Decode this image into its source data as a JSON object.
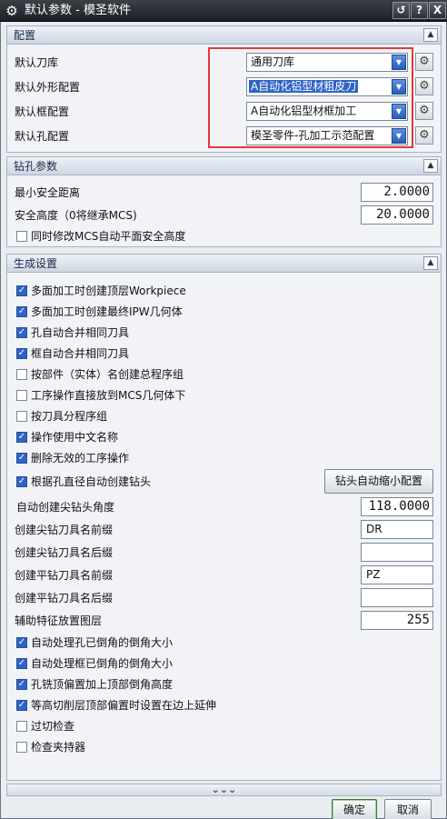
{
  "window": {
    "title": "默认参数 - 模圣软件",
    "btn_restore": "↺",
    "btn_help": "?",
    "btn_close": "X"
  },
  "colors": {
    "accent": "#2f63c5",
    "highlight_box": "#e23a3a"
  },
  "config": {
    "header": "配置",
    "rows": [
      {
        "label": "默认刀库",
        "value": "通用刀库"
      },
      {
        "label": "默认外形配置",
        "value": "A自动化铝型材粗皮刀"
      },
      {
        "label": "默认框配置",
        "value": "A自动化铝型材框加工"
      },
      {
        "label": "默认孔配置",
        "value": "模圣零件-孔加工示范配置"
      }
    ]
  },
  "drill": {
    "header": "钻孔参数",
    "min_safe_label": "最小安全距离",
    "min_safe_value": "2.0000",
    "safe_height_label": "安全高度（0将继承MCS)",
    "safe_height_value": "20.0000",
    "sync_label": "同时修改MCS自动平面安全高度"
  },
  "gen": {
    "header": "生成设置",
    "checks": [
      {
        "label": "多面加工时创建顶层Workpiece"
      },
      {
        "label": "多面加工时创建最终IPW几何体"
      },
      {
        "label": "孔自动合并相同刀具"
      },
      {
        "label": "框自动合并相同刀具"
      },
      {
        "label": "按部件（实体）名创建总程序组"
      },
      {
        "label": "工序操作直接放到MCS几何体下"
      },
      {
        "label": "按刀具分程序组"
      },
      {
        "label": "操作使用中文名称"
      },
      {
        "label": "删除无效的工序操作"
      }
    ],
    "auto_drill_label": "根据孔直径自动创建钻头",
    "auto_drill_button": "钻头自动缩小配置",
    "angle_label": "自动创建尖钻头角度",
    "angle_value": "118.0000",
    "point_prefix_label": "创建尖钻刀具名前缀",
    "point_prefix_value": "DR",
    "point_suffix_label": "创建尖钻刀具名后缀",
    "point_suffix_value": "",
    "flat_prefix_label": "创建平钻刀具名前缀",
    "flat_prefix_value": "PZ",
    "flat_suffix_label": "创建平钻刀具名后缀",
    "flat_suffix_value": "",
    "aux_layer_label": "辅助特征放置图层",
    "aux_layer_value": "255",
    "checks2": [
      {
        "label": "自动处理孔已倒角的倒角大小"
      },
      {
        "label": "自动处理框已倒角的倒角大小"
      },
      {
        "label": "孔铣顶偏置加上顶部倒角高度"
      },
      {
        "label": "等高切削层顶部偏置时设置在边上延伸"
      },
      {
        "label": "过切检查"
      },
      {
        "label": "检查夹持器"
      }
    ]
  },
  "more": "⌄⌄⌄",
  "footer": {
    "ok": "确定",
    "cancel": "取消"
  }
}
